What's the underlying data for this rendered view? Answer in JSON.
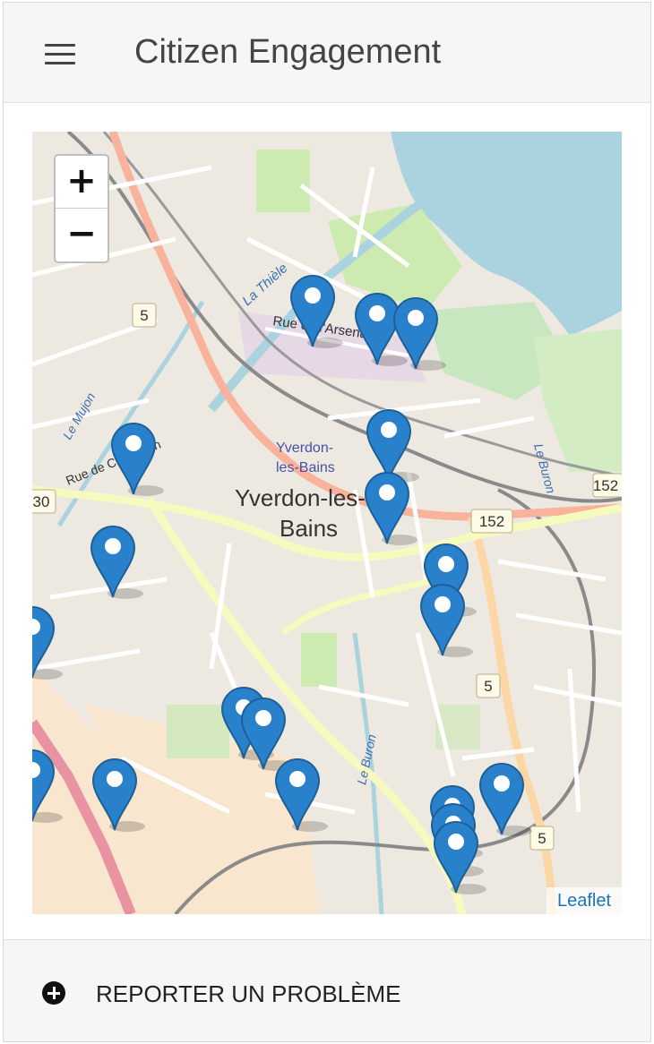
{
  "app": {
    "title": "Citizen Engagement"
  },
  "map": {
    "zoom_in_label": "+",
    "zoom_out_label": "−",
    "attribution": "Leaflet",
    "city_label_line1": "Yverdon-les-",
    "city_label_line2": "Bains",
    "station_label_line1": "Yverdon-",
    "station_label_line2": "les-Bains",
    "street_labels": [
      "Rue de l'Arsenal",
      "Rue de Chamblon",
      "La Thièle",
      "Le Mujon",
      "Le Buron",
      "Le Buron"
    ],
    "route_shields": [
      "5",
      "5",
      "5",
      "152",
      "152",
      "30"
    ],
    "marker_count": 22,
    "marker_color": "#2a81cb"
  },
  "footer": {
    "report_label": "REPORTER UN PROBLÈME"
  }
}
